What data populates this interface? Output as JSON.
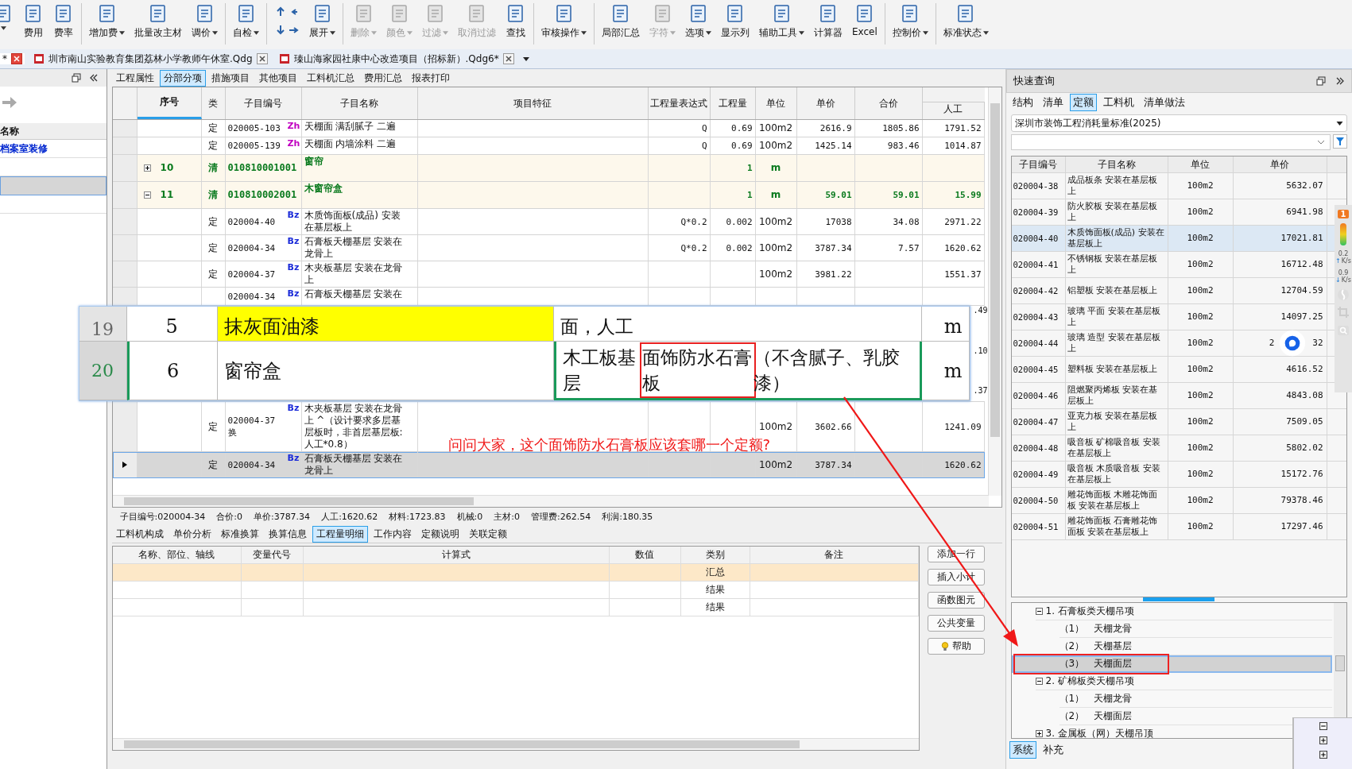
{
  "toolbar": [
    {
      "kind": "tool",
      "caret": true,
      "disabled": false
    },
    {
      "kind": "tool",
      "label": "费用",
      "caret": false,
      "disabled": false
    },
    {
      "kind": "tool",
      "label": "费率",
      "caret": false,
      "disabled": false
    },
    {
      "kind": "separator"
    },
    {
      "kind": "tool",
      "label": "增加费",
      "caret": true,
      "disabled": false
    },
    {
      "kind": "tool",
      "label": "批量改主材",
      "caret": false,
      "disabled": false
    },
    {
      "kind": "tool",
      "label": "调价",
      "caret": true,
      "disabled": false
    },
    {
      "kind": "separator"
    },
    {
      "kind": "tool",
      "label": "自检",
      "caret": true,
      "disabled": false
    },
    {
      "kind": "separator"
    },
    {
      "kind": "arrows"
    },
    {
      "kind": "tool",
      "label": "展开",
      "caret": true,
      "disabled": false
    },
    {
      "kind": "separator"
    },
    {
      "kind": "tool",
      "label": "删除",
      "caret": true,
      "disabled": true
    },
    {
      "kind": "tool",
      "label": "颜色",
      "caret": true,
      "disabled": true
    },
    {
      "kind": "tool",
      "label": "过滤",
      "caret": true,
      "disabled": true
    },
    {
      "kind": "tool",
      "label": "取消过滤",
      "caret": false,
      "disabled": true
    },
    {
      "kind": "tool",
      "label": "查找",
      "caret": false,
      "disabled": false
    },
    {
      "kind": "separator"
    },
    {
      "kind": "tool",
      "label": "审核操作",
      "caret": true,
      "disabled": false
    },
    {
      "kind": "separator"
    },
    {
      "kind": "tool",
      "label": "局部汇总",
      "caret": false,
      "disabled": false
    },
    {
      "kind": "tool",
      "label": "字符",
      "caret": true,
      "disabled": true
    },
    {
      "kind": "tool",
      "label": "选项",
      "caret": true,
      "disabled": false
    },
    {
      "kind": "tool",
      "label": "显示列",
      "caret": false,
      "disabled": false
    },
    {
      "kind": "tool",
      "label": "辅助工具",
      "caret": true,
      "disabled": false
    },
    {
      "kind": "tool",
      "label": "计算器",
      "caret": false,
      "disabled": false
    },
    {
      "kind": "tool",
      "label": "Excel",
      "caret": false,
      "disabled": false
    },
    {
      "kind": "separator"
    },
    {
      "kind": "tool",
      "label": "控制价",
      "caret": true,
      "disabled": false
    },
    {
      "kind": "separator"
    },
    {
      "kind": "tool",
      "label": "标准状态",
      "caret": true,
      "disabled": false
    }
  ],
  "doc_tabs": [
    {
      "label": "*",
      "selected": true
    },
    {
      "label": "圳市南山实验教育集团荔林小学教师午休室.Qdg",
      "selected": false
    },
    {
      "label": "瑧山海家园社康中心改造项目（招标新）.Qdg6*",
      "selected": false
    }
  ],
  "left_pane": {
    "header": "名称",
    "rows": [
      {
        "name": "档案室装修",
        "selected": false
      },
      {
        "selected": false
      },
      {
        "selected": true
      },
      {
        "selected": false
      }
    ]
  },
  "main_tabs": [
    {
      "label": "工程属性",
      "selected": false
    },
    {
      "label": "分部分项",
      "selected": true
    },
    {
      "label": "措施项目",
      "selected": false
    },
    {
      "label": "其他项目",
      "selected": false
    },
    {
      "label": "工料机汇总",
      "selected": false
    },
    {
      "label": "费用汇总",
      "selected": false
    },
    {
      "label": "报表打印",
      "selected": false
    }
  ],
  "table": {
    "columns": [
      "序号",
      "类",
      "子目编号",
      "子目名称",
      "项目特征",
      "工程量表达式",
      "工程量",
      "单位",
      "单价",
      "合价",
      "人工"
    ],
    "rows": [
      {
        "kind": "item",
        "selected": false,
        "type": "定",
        "code": "020005-103",
        "badge": "Zh",
        "name": "天棚面 满刮腻子 二遍",
        "expr": "Q",
        "qty": "0.69",
        "unit": "100m2",
        "price": "2616.9",
        "total": "1805.86",
        "labor": "1791.52"
      },
      {
        "kind": "item",
        "selected": false,
        "type": "定",
        "code": "020005-139",
        "badge": "Zh",
        "name": "天棚面 内墙涂料 二遍",
        "expr": "Q",
        "qty": "0.69",
        "unit": "100m2",
        "price": "1425.14",
        "total": "983.46",
        "labor": "1014.87"
      },
      {
        "kind": "bill",
        "selected": false,
        "expanded": false,
        "seq": "10",
        "type": "清",
        "code": "010810001001",
        "name": "窗帘",
        "qty": "1",
        "unit": "m"
      },
      {
        "kind": "bill",
        "selected": false,
        "expanded": true,
        "seq": "11",
        "type": "清",
        "code": "010810002001",
        "name": "木窗帘盒",
        "qty": "1",
        "unit": "m",
        "price": "59.01",
        "total": "59.01",
        "labor": "15.99"
      },
      {
        "kind": "item",
        "selected": false,
        "type": "定",
        "code": "020004-40",
        "badge": "Bz",
        "name": "木质饰面板(成品) 安装在基层板上",
        "expr": "Q*0.2",
        "qty": "0.002",
        "unit": "100m2",
        "price": "17038",
        "total": "34.08",
        "labor": "2971.22"
      },
      {
        "kind": "item",
        "selected": false,
        "type": "定",
        "code": "020004-34",
        "badge": "Bz",
        "name": "石膏板天棚基层 安装在龙骨上",
        "expr": "Q*0.2",
        "qty": "0.002",
        "unit": "100m2",
        "price": "3787.34",
        "total": "7.57",
        "labor": "1620.62"
      },
      {
        "kind": "item",
        "selected": false,
        "type": "定",
        "code": "020004-37",
        "badge": "Bz",
        "name": "木夹板基层 安装在龙骨上",
        "unit": "100m2",
        "price": "3981.22",
        "labor": "1551.37"
      },
      {
        "kind": "cut",
        "selected": false,
        "code": "020004-34",
        "badge": "Bz",
        "name": "石膏板天棚基层 安装在"
      }
    ],
    "peek": [
      ".49",
      ".10",
      ".37"
    ],
    "rows_after": [
      {
        "kind": "item",
        "selected": false,
        "type": "定",
        "code": "020004-37",
        "code_suffix": "换",
        "badge": "Bz",
        "name": "木夹板基层 安装在龙骨上 ^（设计要求多层基层板时，非首层基层板:人工*0.8）",
        "unit": "100m2",
        "price": "3602.66",
        "labor": "1241.09"
      },
      {
        "kind": "item",
        "selected": true,
        "type": "定",
        "code": "020004-34",
        "badge": "Bz",
        "name": "石膏板天棚基层 安装在龙骨上",
        "unit": "100m2",
        "price": "3787.34",
        "labor": "1620.62"
      }
    ]
  },
  "pasted_clip": {
    "rows": [
      {
        "num": "19",
        "seq": "5",
        "name": "抹灰面油漆",
        "highlight": true,
        "selected": false,
        "feature": "面，人工",
        "unit": "m"
      },
      {
        "num": "20",
        "seq": "6",
        "name": "窗帘盒",
        "highlight": false,
        "selected": true,
        "feature_before": "木工板基层",
        "feature_marked": "面饰防水石膏板",
        "feature_after": "（不含腻子、乳胶漆）",
        "unit": "m"
      }
    ]
  },
  "annotation": "问问大家，这个面饰防水石膏板应该套哪一个定额?",
  "status_line": [
    "子目编号:020004-34",
    "合价:0",
    "单价:3787.34",
    "人工:1620.62",
    "材料:1723.83",
    "机械:0",
    "主材:0",
    "管理费:262.54",
    "利润:180.35"
  ],
  "detail_tabs": [
    {
      "label": "工料机构成",
      "selected": false
    },
    {
      "label": "单价分析",
      "selected": false
    },
    {
      "label": "标准换算",
      "selected": false
    },
    {
      "label": "换算信息",
      "selected": false
    },
    {
      "label": "工程量明细",
      "selected": true
    },
    {
      "label": "工作内容",
      "selected": false
    },
    {
      "label": "定额说明",
      "selected": false
    },
    {
      "label": "关联定额",
      "selected": false
    }
  ],
  "detail_table": {
    "columns": [
      "名称、部位、轴线",
      "变量代号",
      "计算式",
      "数值",
      "类别",
      "备注"
    ],
    "rows": [
      {
        "category": "汇总",
        "selected": true
      },
      {
        "category": "结果",
        "selected": false
      },
      {
        "category": "结果",
        "selected": false
      }
    ]
  },
  "detail_buttons": [
    {
      "kind": "plain",
      "label": "添加一行"
    },
    {
      "kind": "plain",
      "label": "插入小计"
    },
    {
      "kind": "plain",
      "label": "函数图元"
    },
    {
      "kind": "plain",
      "label": "公共变量"
    },
    {
      "kind": "help",
      "label": "帮助"
    }
  ],
  "quick_panel": {
    "title": "快速查询",
    "tabs": [
      {
        "label": "结构",
        "selected": false
      },
      {
        "label": "清单",
        "selected": false
      },
      {
        "label": "定额",
        "selected": true
      },
      {
        "label": "工料机",
        "selected": false
      },
      {
        "label": "清单做法",
        "selected": false
      }
    ],
    "standard": "深圳市装饰工程消耗量标准(2025)",
    "columns": [
      "子目编号",
      "子目名称",
      "单位",
      "单价"
    ],
    "rows": [
      {
        "code": "020004-38",
        "name": "成品板条 安装在基层板上",
        "unit": "100m2",
        "price": "5632.07",
        "selected": false
      },
      {
        "code": "020004-39",
        "name": "防火胶板 安装在基层板上",
        "unit": "100m2",
        "price": "6941.98",
        "selected": false
      },
      {
        "code": "020004-40",
        "name": "木质饰面板(成品) 安装在基层板上",
        "unit": "100m2",
        "price": "17021.81",
        "selected": true
      },
      {
        "code": "020004-41",
        "name": "不锈钢板 安装在基层板上",
        "unit": "100m2",
        "price": "16712.48",
        "selected": false
      },
      {
        "code": "020004-42",
        "name": "铝塑板 安装在基层板上",
        "unit": "100m2",
        "price": "12704.59",
        "selected": false
      },
      {
        "code": "020004-43",
        "name": "玻璃 平面 安装在基层板上",
        "unit": "100m2",
        "price": "14097.25",
        "selected": false
      },
      {
        "code": "020004-44",
        "name": "玻璃 造型 安装在基层板上",
        "unit": "100m2",
        "price": "2",
        "price_tail": "32",
        "selected": false
      },
      {
        "code": "020004-45",
        "name": "塑料板 安装在基层板上",
        "unit": "100m2",
        "price": "4616.52",
        "selected": false
      },
      {
        "code": "020004-46",
        "name": "阻燃聚丙烯板 安装在基层板上",
        "unit": "100m2",
        "price": "4843.08",
        "selected": false
      },
      {
        "code": "020004-47",
        "name": "亚克力板 安装在基层板上",
        "unit": "100m2",
        "price": "7509.05",
        "selected": false
      },
      {
        "code": "020004-48",
        "name": "吸音板 矿棉吸音板 安装在基层板上",
        "unit": "100m2",
        "price": "5802.02",
        "selected": false
      },
      {
        "code": "020004-49",
        "name": "吸音板 木质吸音板 安装在基层板上",
        "unit": "100m2",
        "price": "15172.76",
        "selected": false
      },
      {
        "code": "020004-50",
        "name": "雕花饰面板 木雕花饰面板 安装在基层板上",
        "unit": "100m2",
        "price": "79378.46",
        "selected": false
      },
      {
        "code": "020004-51",
        "name": "雕花饰面板 石膏雕花饰面板 安装在基层板上",
        "unit": "100m2",
        "price": "17297.46",
        "selected": false
      }
    ],
    "tree": [
      {
        "label": "1. 石膏板类天棚吊项",
        "expanded": true,
        "selected": false,
        "children": [
          {
            "label": "（1）　天棚龙骨",
            "selected": false
          },
          {
            "label": "（2）　天棚基层",
            "selected": false
          },
          {
            "label": "（3）　天棚面层",
            "selected": true
          }
        ]
      },
      {
        "label": "2. 矿棉板类天棚吊项",
        "expanded": true,
        "selected": false,
        "children": [
          {
            "label": "（1）　天棚龙骨",
            "selected": false
          },
          {
            "label": "（2）　天棚面层",
            "selected": false
          }
        ]
      },
      {
        "label": "3. 金属板（网）天棚吊顶",
        "expanded": false,
        "selected": false
      }
    ],
    "bottom_tabs": [
      {
        "label": "系统",
        "selected": true
      },
      {
        "label": "补充",
        "selected": false
      }
    ]
  },
  "side_widget": {
    "badge": "1",
    "speeds": [
      {
        "value": "0.2",
        "unit": "K/s",
        "arrow": "↑"
      },
      {
        "value": "0.9",
        "unit": "K/s",
        "arrow": "↓"
      }
    ]
  }
}
